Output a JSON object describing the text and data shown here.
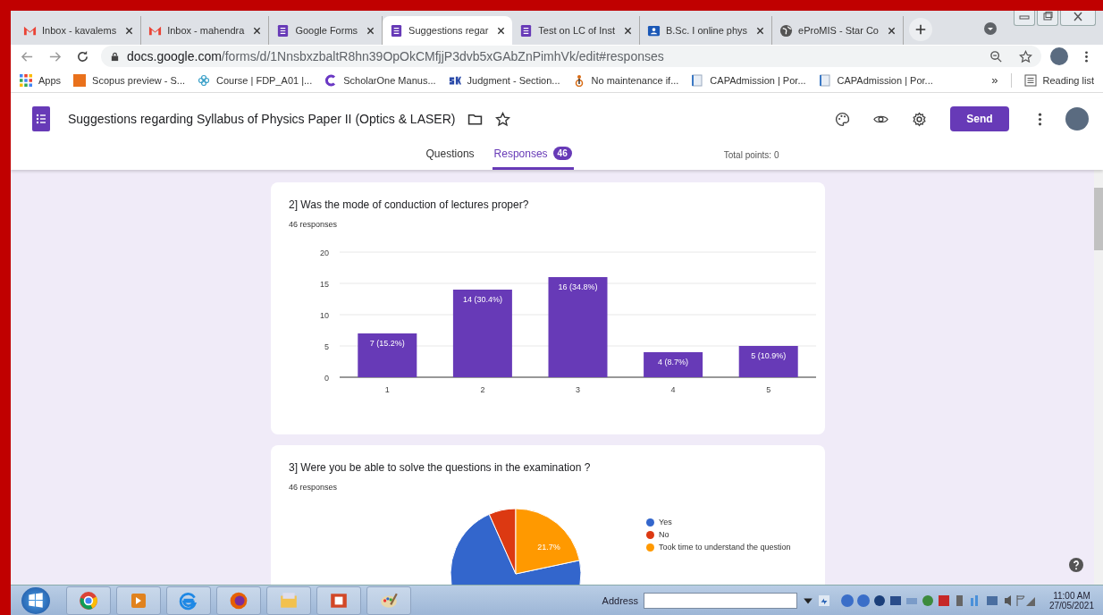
{
  "browser_tabs": [
    {
      "title": "Inbox - kavalems",
      "kind": "gmail",
      "selected": false
    },
    {
      "title": "Inbox - mahendra",
      "kind": "gmail",
      "selected": false
    },
    {
      "title": "Google Forms",
      "kind": "forms",
      "selected": false
    },
    {
      "title": "Suggestions regar",
      "kind": "forms",
      "selected": true
    },
    {
      "title": "Test on LC of Inst",
      "kind": "forms",
      "selected": false
    },
    {
      "title": "B.Sc. I online phys",
      "kind": "classroom",
      "selected": false
    },
    {
      "title": "eProMIS - Star Co",
      "kind": "globe",
      "selected": false
    }
  ],
  "address_bar": {
    "host": "docs.google.com",
    "path": "/forms/d/1NnsbxzbaltR8hn39OpOkCMfjjP3dvb5xGAbZnPimhVk/edit#responses"
  },
  "bookmarks": [
    {
      "label": "Apps",
      "kind": "apps"
    },
    {
      "label": "Scopus preview - S...",
      "kind": "sc"
    },
    {
      "label": "Course | FDP_A01 |...",
      "kind": "flower"
    },
    {
      "label": "ScholarOne Manus...",
      "kind": "ring"
    },
    {
      "label": "Judgment - Section...",
      "kind": "sk"
    },
    {
      "label": "No maintenance if...",
      "kind": "figure"
    },
    {
      "label": "CAPAdmission | Por...",
      "kind": "page"
    },
    {
      "label": "CAPAdmission | Por...",
      "kind": "page"
    }
  ],
  "bookmarks_more": "»",
  "reading_list": "Reading list",
  "form": {
    "title": "Suggestions regarding Syllabus of Physics Paper II (Optics & LASER)",
    "send": "Send",
    "tabs": [
      {
        "label": "Questions",
        "selected": false
      },
      {
        "label": "Responses",
        "selected": true,
        "badge": "46"
      }
    ],
    "total_points": "Total points: 0"
  },
  "questions": [
    {
      "title": "2] Was the mode of conduction of lectures proper?",
      "responses": "46 responses",
      "chart_data": {
        "type": "bar",
        "categories": [
          "1",
          "2",
          "3",
          "4",
          "5"
        ],
        "values": [
          7,
          14,
          16,
          4,
          5
        ],
        "ylim": [
          0,
          20
        ],
        "yticks": [
          0,
          5,
          10,
          15,
          20
        ],
        "grid": true,
        "value_labels": [
          "7 (15.2%)",
          "14 (30.4%)",
          "16 (34.8%)",
          "4 (8.7%)",
          "5 (10.9%)"
        ]
      }
    },
    {
      "title": "3] Were you be able to solve the questions in the examination ?",
      "responses": "46 responses",
      "pie_label": "21.7%",
      "legend": [
        {
          "label": "Yes",
          "color": "#3366cc"
        },
        {
          "label": "No",
          "color": "#dc3912"
        },
        {
          "label": "Took time to understand the question",
          "color": "#ff9900"
        }
      ]
    }
  ],
  "taskbar": {
    "address_label": "Address",
    "time": "11:00 AM",
    "date": "27/05/2021"
  }
}
